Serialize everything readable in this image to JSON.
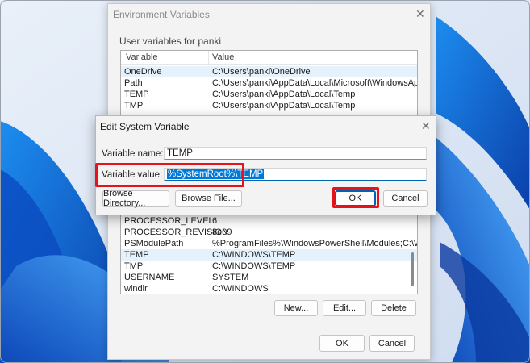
{
  "env": {
    "title": "Environment Variables",
    "user_group_label": "User variables for panki",
    "columns": {
      "variable": "Variable",
      "value": "Value"
    },
    "user_vars": [
      {
        "name": "OneDrive",
        "value": "C:\\Users\\panki\\OneDrive",
        "selected": true
      },
      {
        "name": "Path",
        "value": "C:\\Users\\panki\\AppData\\Local\\Microsoft\\WindowsApps;",
        "selected": false
      },
      {
        "name": "TEMP",
        "value": "C:\\Users\\panki\\AppData\\Local\\Temp",
        "selected": false
      },
      {
        "name": "TMP",
        "value": "C:\\Users\\panki\\AppData\\Local\\Temp",
        "selected": false
      }
    ],
    "system_vars": [
      {
        "name": "PROCESSOR_LEVEL",
        "value": "6",
        "selected": false
      },
      {
        "name": "PROCESSOR_REVISION",
        "value": "8e09",
        "selected": false
      },
      {
        "name": "PSModulePath",
        "value": "%ProgramFiles%\\WindowsPowerShell\\Modules;C:\\WINDOWS...",
        "selected": false
      },
      {
        "name": "TEMP",
        "value": "C:\\WINDOWS\\TEMP",
        "selected": true
      },
      {
        "name": "TMP",
        "value": "C:\\WINDOWS\\TEMP",
        "selected": false
      },
      {
        "name": "USERNAME",
        "value": "SYSTEM",
        "selected": false
      },
      {
        "name": "windir",
        "value": "C:\\WINDOWS",
        "selected": false
      }
    ],
    "buttons": {
      "new": "New...",
      "edit": "Edit...",
      "delete": "Delete",
      "ok": "OK",
      "cancel": "Cancel"
    }
  },
  "edit": {
    "title": "Edit System Variable",
    "name_label": "Variable name:",
    "name_value": "TEMP",
    "value_label": "Variable value:",
    "value_value": "%SystemRoot%\\TEMP",
    "buttons": {
      "browse_directory": "Browse Directory...",
      "browse_file": "Browse File...",
      "ok": "OK",
      "cancel": "Cancel"
    }
  },
  "colors": {
    "accent": "#0063b1",
    "highlight": "#e3141b",
    "selection": "#0078d7"
  }
}
